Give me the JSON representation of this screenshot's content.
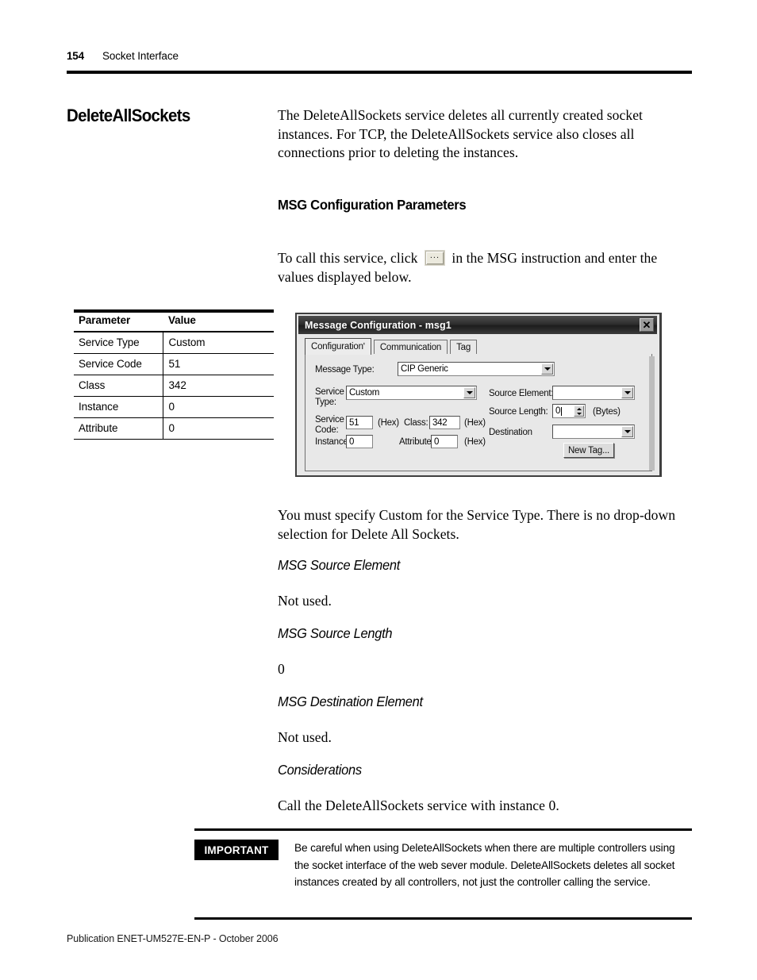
{
  "header": {
    "page_number": "154",
    "chapter_title": "Socket Interface"
  },
  "section": {
    "heading": "DeleteAllSockets",
    "intro_paragraph": "The DeleteAllSockets service deletes all currently created socket instances. For TCP, the DeleteAllSockets service also closes all connections prior to deleting the instances."
  },
  "msg_config": {
    "heading": "MSG Configuration Parameters",
    "call_text_before": "To call this service, click",
    "call_button_icon": "ellipsis-button",
    "call_text_after": "in the MSG instruction and enter the values displayed below.",
    "note_paragraph": "You must specify Custom for the Service Type. There is no drop-down selection for Delete All Sockets."
  },
  "param_table": {
    "columns": [
      "Parameter",
      "Value"
    ],
    "rows": [
      [
        "Service Type",
        "Custom"
      ],
      [
        "Service Code",
        "51"
      ],
      [
        "Class",
        "342"
      ],
      [
        "Instance",
        "0"
      ],
      [
        "Attribute",
        "0"
      ]
    ]
  },
  "dialog": {
    "title": "Message Configuration - msg1",
    "close_label": "✕",
    "tabs": [
      {
        "label": "Configurationʹ",
        "active": true
      },
      {
        "label": "Communication",
        "active": false
      },
      {
        "label": "Tag",
        "active": false
      }
    ],
    "fields": {
      "message_type_label": "Message Type:",
      "message_type_value": "CIP Generic",
      "service_type_label_line1": "Service",
      "service_type_label_line2": "Type:",
      "service_type_value": "Custom",
      "service_code_label_line1": "Service",
      "service_code_label_line2": "Code:",
      "service_code_value": "51",
      "service_code_hex": "(Hex)",
      "class_label": "Class:",
      "class_value": "342",
      "class_hex": "(Hex)",
      "instance_label": "Instance:",
      "instance_value": "0",
      "attribute_label": "Attribute:",
      "attribute_value": "0",
      "attribute_hex": "(Hex)",
      "source_element_label": "Source Element:",
      "source_element_value": "",
      "source_length_label": "Source Length:",
      "source_length_value": "0",
      "source_length_units": "(Bytes)",
      "destination_label": "Destination",
      "destination_value": "",
      "new_tag_button": "New Tag..."
    }
  },
  "subsections": [
    {
      "heading": "MSG Source Element",
      "body": "Not used."
    },
    {
      "heading": "MSG Source Length",
      "body": "0"
    },
    {
      "heading": "MSG Destination Element",
      "body": "Not used."
    },
    {
      "heading": "Considerations",
      "body": "Call the DeleteAllSockets service with instance 0."
    }
  ],
  "important": {
    "badge": "IMPORTANT",
    "text": "Be careful when using DeleteAllSockets when there are multiple controllers using the socket interface of the web sever module. DeleteAllSockets deletes all socket instances created by all controllers, not just the controller calling the service."
  },
  "footer": {
    "publication": "Publication ENET-UM527E-EN-P - October 2006"
  }
}
